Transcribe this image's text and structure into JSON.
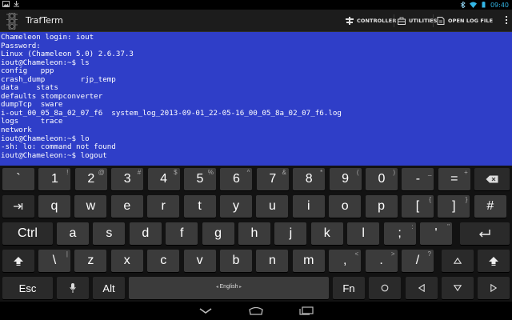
{
  "status_bar": {
    "time": "09:40",
    "icons_left": [
      "image-icon",
      "download-icon"
    ],
    "icons_right": [
      "bluetooth-icon",
      "wifi-icon",
      "battery-icon"
    ]
  },
  "app": {
    "title": "TrafTerm",
    "icon": "traffic-light-icon"
  },
  "actions": [
    {
      "label": "CONTROLLER",
      "icon": "controller-icon"
    },
    {
      "label": "UTILITIES",
      "icon": "toolbox-icon"
    },
    {
      "label": "OPEN LOG FILE",
      "icon": "open-file-icon"
    }
  ],
  "terminal": {
    "background": "#2f3ec8",
    "lines": [
      "Chameleon login: iout",
      "Password:",
      "Linux (Chameleon 5.0) 2.6.37.3",
      "iout@Chameleon:~$ ls",
      "config   ppp",
      "crash_dump        rjp_temp",
      "data    stats",
      "defaults stompconverter",
      "dumpTcp  sware",
      "i-out_00_05_8a_02_07_f6  system_log_2013-09-01_22-05-16_00_05_8a_02_07_f6.log",
      "logs     trace",
      "network",
      "iout@Chameleon:~$ lo",
      "-sh: lo: command not found",
      "iout@Chameleon:~$ logout"
    ]
  },
  "keyboard": {
    "row1": [
      {
        "main": "`",
        "sub": ""
      },
      {
        "main": "1",
        "sub": "!"
      },
      {
        "main": "2",
        "sub": "@"
      },
      {
        "main": "3",
        "sub": "#"
      },
      {
        "main": "4",
        "sub": "$"
      },
      {
        "main": "5",
        "sub": "%"
      },
      {
        "main": "6",
        "sub": "^"
      },
      {
        "main": "7",
        "sub": "&"
      },
      {
        "main": "8",
        "sub": "*"
      },
      {
        "main": "9",
        "sub": "("
      },
      {
        "main": "0",
        "sub": ")"
      },
      {
        "main": "-",
        "sub": "_"
      },
      {
        "main": "=",
        "sub": "+"
      }
    ],
    "row2": [
      {
        "main": "q",
        "sub": ""
      },
      {
        "main": "w",
        "sub": ""
      },
      {
        "main": "e",
        "sub": ""
      },
      {
        "main": "r",
        "sub": ""
      },
      {
        "main": "t",
        "sub": ""
      },
      {
        "main": "y",
        "sub": ""
      },
      {
        "main": "u",
        "sub": ""
      },
      {
        "main": "i",
        "sub": ""
      },
      {
        "main": "o",
        "sub": ""
      },
      {
        "main": "p",
        "sub": ""
      },
      {
        "main": "[",
        "sub": "{"
      },
      {
        "main": "]",
        "sub": "}"
      },
      {
        "main": "#",
        "sub": ""
      }
    ],
    "row3": [
      {
        "main": "a",
        "sub": ""
      },
      {
        "main": "s",
        "sub": ""
      },
      {
        "main": "d",
        "sub": ""
      },
      {
        "main": "f",
        "sub": ""
      },
      {
        "main": "g",
        "sub": ""
      },
      {
        "main": "h",
        "sub": ""
      },
      {
        "main": "j",
        "sub": ""
      },
      {
        "main": "k",
        "sub": ""
      },
      {
        "main": "l",
        "sub": ""
      },
      {
        "main": ";",
        "sub": ":"
      },
      {
        "main": "'",
        "sub": "\""
      }
    ],
    "row4": [
      {
        "main": "\\",
        "sub": "|"
      },
      {
        "main": "z",
        "sub": ""
      },
      {
        "main": "x",
        "sub": ""
      },
      {
        "main": "c",
        "sub": ""
      },
      {
        "main": "v",
        "sub": ""
      },
      {
        "main": "b",
        "sub": ""
      },
      {
        "main": "n",
        "sub": ""
      },
      {
        "main": "m",
        "sub": ""
      },
      {
        "main": ",",
        "sub": "<"
      },
      {
        "main": ".",
        "sub": ">"
      },
      {
        "main": "/",
        "sub": "?"
      }
    ],
    "ctrl_label": "Ctrl",
    "esc_label": "Esc",
    "alt_label": "Alt",
    "fn_label": "Fn",
    "space_label": "English"
  },
  "nav": [
    "back-icon",
    "home-icon",
    "recents-icon"
  ]
}
